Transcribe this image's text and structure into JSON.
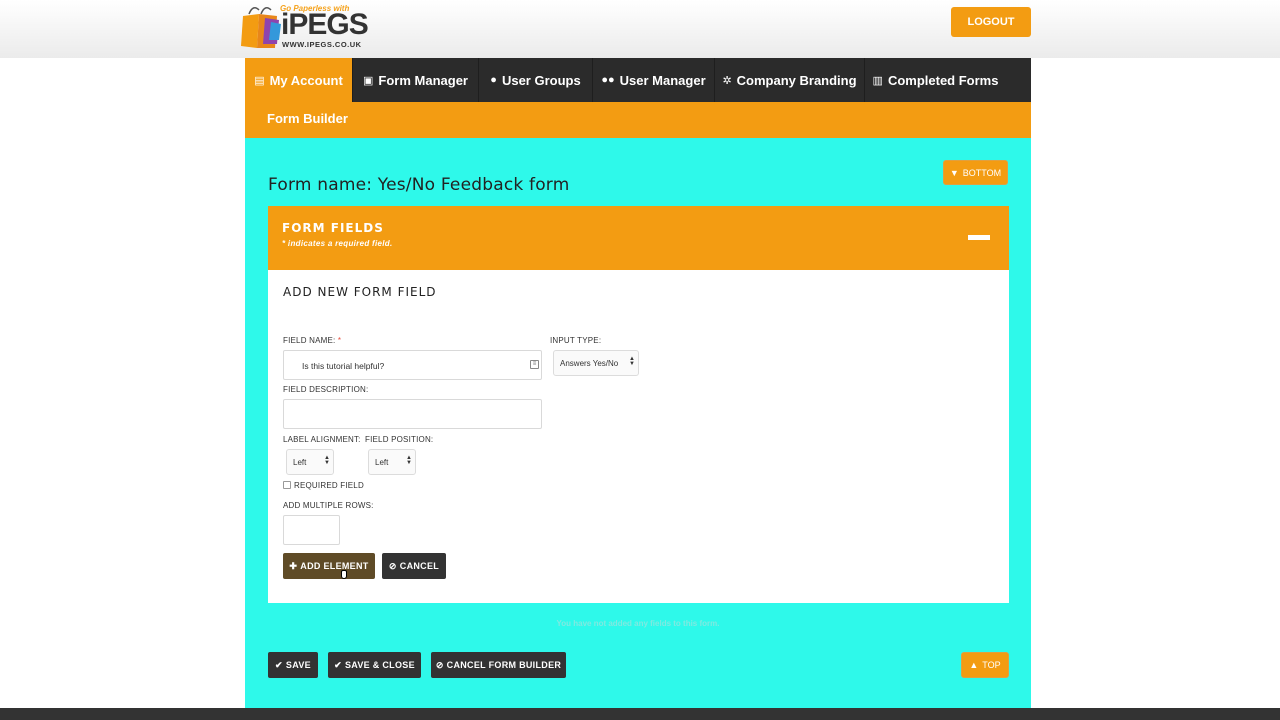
{
  "logo": {
    "tagline": "Go Paperless with",
    "wordmark": "iPEGS",
    "url": "WWW.IPEGS.CO.UK"
  },
  "header": {
    "logout_label": "LOGOUT"
  },
  "nav": {
    "items": [
      {
        "label": "My Account",
        "icon": "document-icon"
      },
      {
        "label": "Form Manager",
        "icon": "form-icon"
      },
      {
        "label": "User Groups",
        "icon": "user-icon"
      },
      {
        "label": "User Manager",
        "icon": "users-icon"
      },
      {
        "label": "Company Branding",
        "icon": "gears-icon"
      },
      {
        "label": "Completed Forms",
        "icon": "clipboard-icon"
      }
    ],
    "active": "My Account",
    "sub_item": "Form Builder"
  },
  "main": {
    "form_title": "Form name: Yes/No Feedback form",
    "bottom_label": "BOTTOM",
    "top_label": "TOP",
    "empty_note": "You have not added any fields to this form."
  },
  "panel": {
    "title": "FORM FIELDS",
    "subtitle": "* indicates a required field."
  },
  "add_field": {
    "section_title": "ADD NEW FORM FIELD",
    "field_name_label": "FIELD NAME:",
    "required_marker": "*",
    "field_name_value": "Is this tutorial helpful?",
    "input_type_label": "INPUT TYPE:",
    "input_type_value": "Answers Yes/No",
    "field_description_label": "FIELD DESCRIPTION:",
    "field_description_value": "",
    "label_alignment_label": "LABEL ALIGNMENT:",
    "label_alignment_value": "Left",
    "field_position_label": "FIELD POSITION:",
    "field_position_value": "Left",
    "required_field_label": "REQUIRED FIELD",
    "required_checked": false,
    "multiple_rows_label": "ADD MULTIPLE ROWS:",
    "multiple_rows_value": "",
    "add_element_label": "ADD ELEMENT",
    "cancel_label": "CANCEL"
  },
  "actions": {
    "save_label": "SAVE",
    "save_close_label": "SAVE & CLOSE",
    "cancel_builder_label": "CANCEL FORM BUILDER"
  },
  "colors": {
    "accent": "#f39c12",
    "background": "#2ef9ea",
    "nav": "#2b2b2b",
    "button_dark": "#333333",
    "button_olive": "#5f4b27"
  }
}
